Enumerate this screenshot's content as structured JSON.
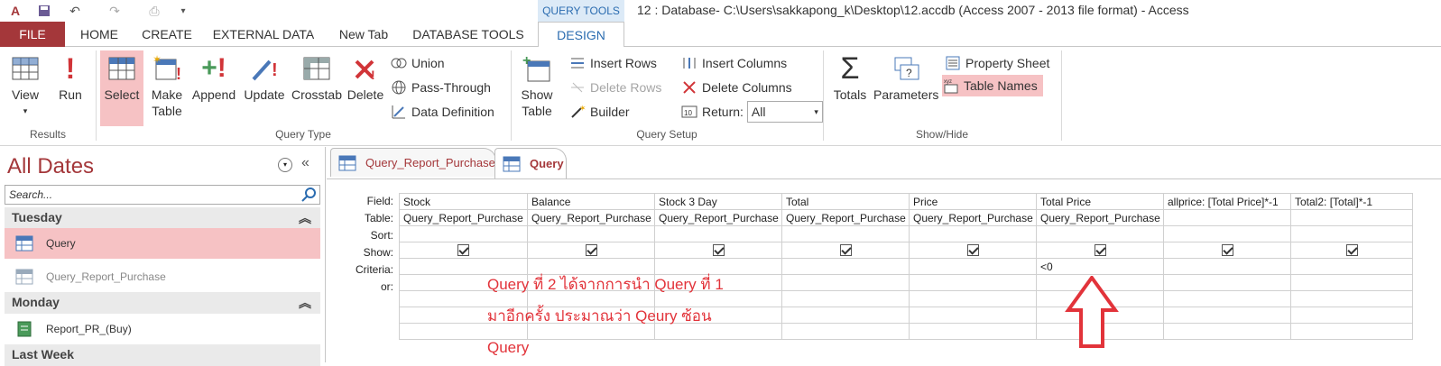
{
  "titlebar": {
    "context_tab": "QUERY TOOLS",
    "title": "12 : Database- C:\\Users\\sakkapong_k\\Desktop\\12.accdb (Access 2007 - 2013 file format) - Access"
  },
  "tabs": [
    "FILE",
    "HOME",
    "CREATE",
    "EXTERNAL DATA",
    "New Tab",
    "DATABASE TOOLS",
    "DESIGN"
  ],
  "ribbon": {
    "results": {
      "label": "Results",
      "view": "View",
      "run": "Run"
    },
    "query_type": {
      "label": "Query Type",
      "select": "Select",
      "make_table_1": "Make",
      "make_table_2": "Table",
      "append": "Append",
      "update": "Update",
      "crosstab": "Crosstab",
      "delete": "Delete",
      "union": "Union",
      "pass_through": "Pass-Through",
      "data_definition": "Data Definition"
    },
    "query_setup": {
      "label": "Query Setup",
      "show_table_1": "Show",
      "show_table_2": "Table",
      "insert_rows": "Insert Rows",
      "delete_rows": "Delete Rows",
      "builder": "Builder",
      "insert_columns": "Insert Columns",
      "delete_columns": "Delete Columns",
      "return_label": "Return:",
      "return_value": "All"
    },
    "show_hide": {
      "label": "Show/Hide",
      "totals": "Totals",
      "parameters": "Parameters",
      "property_sheet": "Property Sheet",
      "table_names": "Table Names"
    }
  },
  "nav": {
    "title": "All Dates",
    "search_placeholder": "Search...",
    "groups": [
      {
        "name": "Tuesday",
        "items": [
          {
            "label": "Query"
          },
          {
            "label": "Query_Report_Purchase"
          }
        ]
      },
      {
        "name": "Monday",
        "items": [
          {
            "label": "Report_PR_(Buy)"
          }
        ]
      },
      {
        "name": "Last Week"
      }
    ]
  },
  "doctabs": [
    "Query_Report_Purchase",
    "Query"
  ],
  "grid": {
    "row_labels": [
      "Field:",
      "Table:",
      "Sort:",
      "Show:",
      "Criteria:",
      "or:"
    ],
    "columns": [
      {
        "field": "Stock",
        "table": "Query_Report_Purchase",
        "criteria": ""
      },
      {
        "field": "Balance",
        "table": "Query_Report_Purchase",
        "criteria": ""
      },
      {
        "field": "Stock 3 Day",
        "table": "Query_Report_Purchase",
        "criteria": ""
      },
      {
        "field": "Total",
        "table": "Query_Report_Purchase",
        "criteria": ""
      },
      {
        "field": "Price",
        "table": "Query_Report_Purchase",
        "criteria": ""
      },
      {
        "field": "Total Price",
        "table": "Query_Report_Purchase",
        "criteria": "<0"
      },
      {
        "field": "allprice: [Total Price]*-1",
        "table": "",
        "criteria": ""
      },
      {
        "field": "Total2: [Total]*-1",
        "table": "",
        "criteria": ""
      }
    ]
  },
  "annotation": {
    "line1": "Query ที่ 2 ได้จากการนำ Query ที่ 1",
    "line2": "มาอีกครั้ง ประมาณว่า Qeury ซ้อน",
    "line3": "Query"
  },
  "colors": {
    "accent": "#a4373a",
    "highlight": "#f6c2c4",
    "annotation": "#e2333a"
  }
}
